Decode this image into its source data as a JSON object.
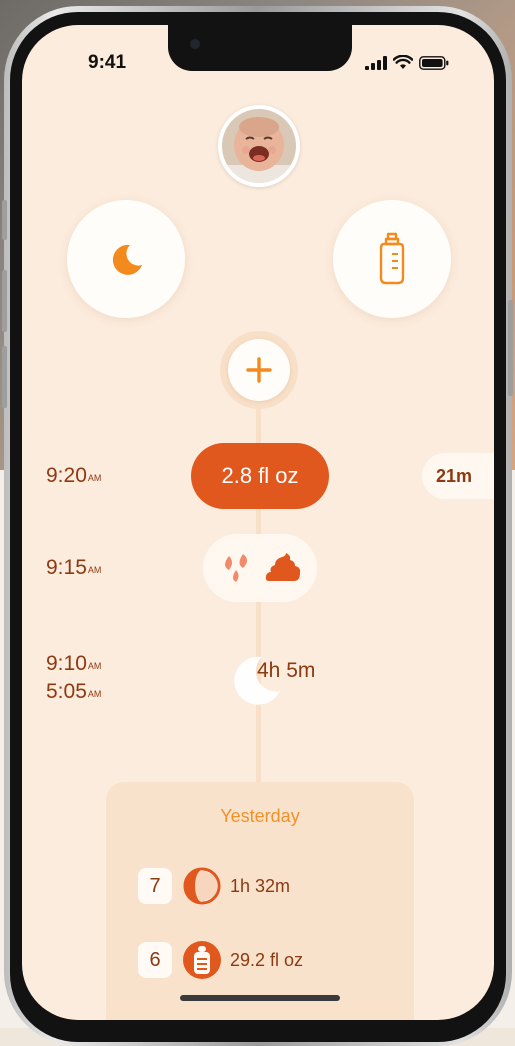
{
  "status_bar": {
    "time": "9:41",
    "icons": [
      "cellular-signal-icon",
      "wifi-icon",
      "battery-icon"
    ]
  },
  "profile": {
    "avatar": "baby-avatar"
  },
  "quick_actions": [
    {
      "name": "sleep",
      "icon": "moon-icon"
    },
    {
      "name": "feeding",
      "icon": "bottle-icon"
    }
  ],
  "add_button": {
    "icon": "plus-icon"
  },
  "timeline": [
    {
      "time": "9:20",
      "ampm": "AM",
      "type": "feeding",
      "value": "2.8 fl oz",
      "since": "21m"
    },
    {
      "time": "9:15",
      "ampm": "AM",
      "type": "diaper",
      "icons": [
        "pee-drops-icon",
        "poop-icon"
      ]
    },
    {
      "type": "sleep",
      "end_time": "9:10",
      "end_ampm": "AM",
      "start_time": "5:05",
      "start_ampm": "AM",
      "duration": "4h 5m"
    }
  ],
  "yesterday": {
    "title": "Yesterday",
    "rows": [
      {
        "count": "7",
        "icon": "sleep-clock-icon",
        "value": "1h 32m"
      },
      {
        "count": "6",
        "icon": "bottle-icon",
        "value": "29.2 fl oz"
      }
    ]
  },
  "colors": {
    "screen_background": "#fcecdd",
    "accent_orange": "#e0581e",
    "icon_orange": "#f28a1e",
    "text_brown": "#8c3a12",
    "yesterday_title": "#f0922a"
  }
}
